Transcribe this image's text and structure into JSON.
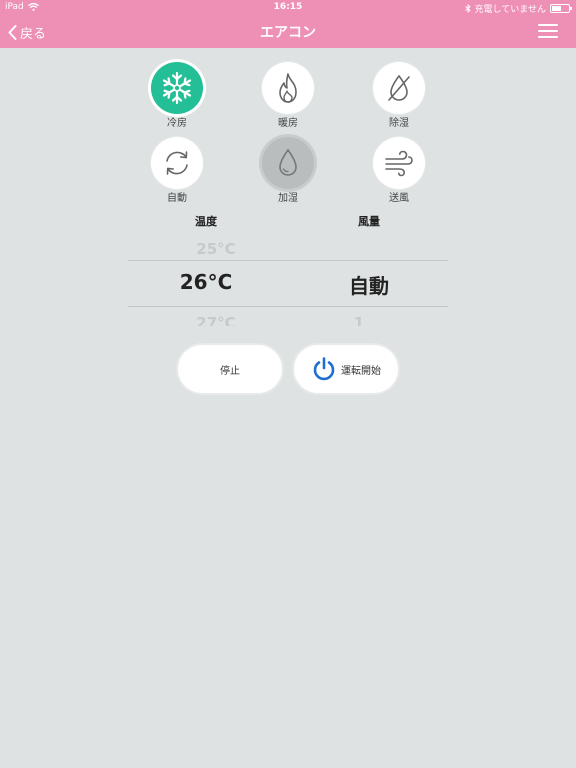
{
  "status_bar": {
    "device": "iPad",
    "time": "16:15",
    "charge_text": "充電していません"
  },
  "nav": {
    "back_label": "戻る",
    "title": "エアコン"
  },
  "modes": [
    {
      "label": "冷房",
      "icon": "snowflake-icon",
      "state": "selected"
    },
    {
      "label": "暖房",
      "icon": "flame-icon",
      "state": "normal"
    },
    {
      "label": "除湿",
      "icon": "drop-slash-icon",
      "state": "normal"
    },
    {
      "label": "自動",
      "icon": "cycle-arrows-icon",
      "state": "normal"
    },
    {
      "label": "加湿",
      "icon": "water-drop-icon",
      "state": "disabled"
    },
    {
      "label": "送風",
      "icon": "wind-icon",
      "state": "normal"
    }
  ],
  "picker": {
    "temp_header": "温度",
    "fan_header": "風量",
    "temp_prev": "25°C",
    "temp_current": "26°C",
    "temp_next": "27°C",
    "fan_current": "自動",
    "fan_next": "1"
  },
  "actions": {
    "stop_label": "停止",
    "start_label": "運転開始"
  },
  "colors": {
    "nav_bar": "#ee8fb5",
    "selected_mode": "#24bf96",
    "power_icon": "#1f6fd1",
    "background": "#dfe2e2"
  }
}
